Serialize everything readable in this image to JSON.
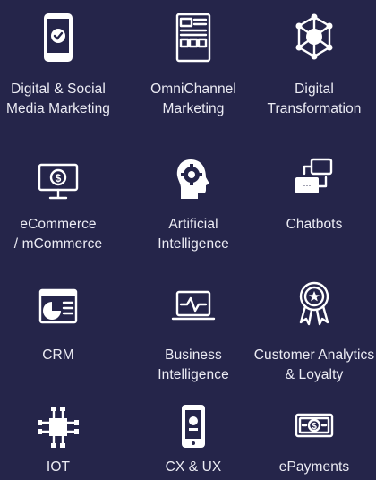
{
  "services": [
    {
      "icon": "smartphone-check-icon",
      "label": "Digital & Social\nMedia Marketing"
    },
    {
      "icon": "omnichannel-layout-icon",
      "label": "OmniChannel\nMarketing"
    },
    {
      "icon": "network-hub-icon",
      "label": "Digital\nTransformation"
    },
    {
      "icon": "monitor-dollar-icon",
      "label": "eCommerce\n/ mCommerce"
    },
    {
      "icon": "head-gear-icon",
      "label": "Artificial\nIntelligence"
    },
    {
      "icon": "chat-bubbles-icon",
      "label": "Chatbots"
    },
    {
      "icon": "crm-chart-icon",
      "label": "CRM"
    },
    {
      "icon": "laptop-pulse-icon",
      "label": "Business\nIntelligence"
    },
    {
      "icon": "award-ribbon-icon",
      "label": "Customer Analytics\n& Loyalty"
    },
    {
      "icon": "iot-circuit-icon",
      "label": "IOT"
    },
    {
      "icon": "mobile-touch-icon",
      "label": "CX & UX"
    },
    {
      "icon": "banknote-icon",
      "label": "ePayments"
    }
  ]
}
